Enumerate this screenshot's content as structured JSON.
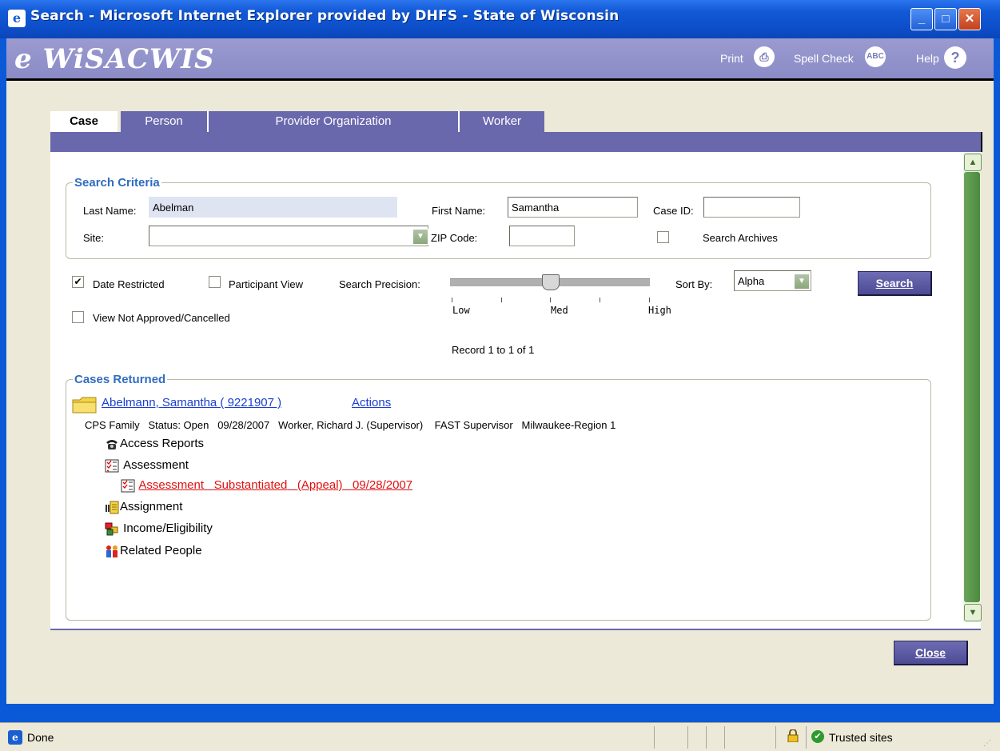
{
  "window": {
    "title": "Search - Microsoft Internet Explorer provided by DHFS - State of Wisconsin",
    "icon": "ie-icon",
    "controls": [
      "minimize-icon",
      "maximize-icon",
      "close-icon"
    ]
  },
  "header": {
    "logo": "e WiSACWIS",
    "print_label": "Print",
    "spellcheck_label": "Spell Check",
    "help_label": "Help",
    "print_icon": "printer-icon",
    "spellcheck_icon": "abc-check-icon",
    "help_icon": "question-icon"
  },
  "tabs": [
    {
      "label": "Case",
      "active": true
    },
    {
      "label": "Person",
      "active": false
    },
    {
      "label": "Provider Organization",
      "active": false
    },
    {
      "label": "Worker",
      "active": false
    }
  ],
  "criteria": {
    "legend": "Search Criteria",
    "last_name_label": "Last Name:",
    "last_name_value": "Abelman",
    "first_name_label": "First Name:",
    "first_name_value": "Samantha",
    "case_id_label": "Case ID:",
    "case_id_value": "",
    "site_label": "Site:",
    "site_value": "",
    "zip_label": "ZIP Code:",
    "zip_value": "",
    "search_archives_label": "Search Archives",
    "search_archives_checked": false
  },
  "options": {
    "date_restricted_label": "Date Restricted",
    "date_restricted_checked": true,
    "participant_view_label": "Participant View",
    "participant_view_checked": false,
    "precision_label": "Search Precision:",
    "precision_low": "Low",
    "precision_med": "Med",
    "precision_high": "High",
    "precision_level": 0.5,
    "sort_label": "Sort By:",
    "sort_value": "Alpha",
    "search_button": "Search",
    "view_not_approved_label": "View Not Approved/Cancelled",
    "view_not_approved_checked": false
  },
  "record_count": "Record 1 to 1 of 1",
  "results": {
    "legend": "Cases Returned",
    "case_link": "Abelmann, Samantha ( 9221907 )",
    "actions_link": "Actions",
    "details": {
      "type": "CPS Family",
      "status": "Status: Open",
      "date": "09/28/2007",
      "worker": "Worker, Richard J. (Supervisor)",
      "role": "FAST Supervisor",
      "region": "Milwaukee-Region 1"
    },
    "tree": [
      {
        "label": "Access Reports",
        "icon": "telephone-icon"
      },
      {
        "label": "Assessment",
        "icon": "checklist-icon"
      },
      {
        "label": "Assignment",
        "icon": "assignment-icon"
      },
      {
        "label": "Income/Eligibility",
        "icon": "income-icon"
      },
      {
        "label": "Related People",
        "icon": "people-icon"
      }
    ],
    "assessment_sub": {
      "title": "Assessment",
      "finding": "Substantiated",
      "appeal": "(Appeal)",
      "date": "09/28/2007"
    }
  },
  "close_button": "Close",
  "status": {
    "text": "Done",
    "zone": "Trusted sites",
    "lock_icon": "lock-icon",
    "zone_icon": "trusted-check-icon"
  }
}
